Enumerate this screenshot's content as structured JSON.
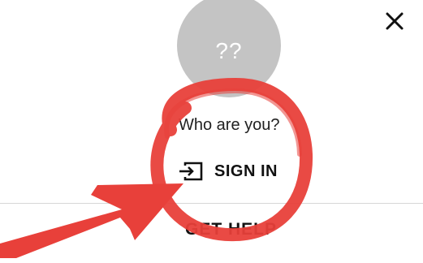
{
  "dialog": {
    "close_icon": "close-icon",
    "avatar_text": "??",
    "prompt": "Who are you?",
    "sign_in_label": "SIGN IN",
    "sign_in_icon": "sign-in-icon",
    "get_help_label": "GET HELP"
  },
  "colors": {
    "avatar": "#c4c4c4",
    "annotation": "#e8403a",
    "text": "#111111",
    "divider": "#d6d6d6"
  }
}
